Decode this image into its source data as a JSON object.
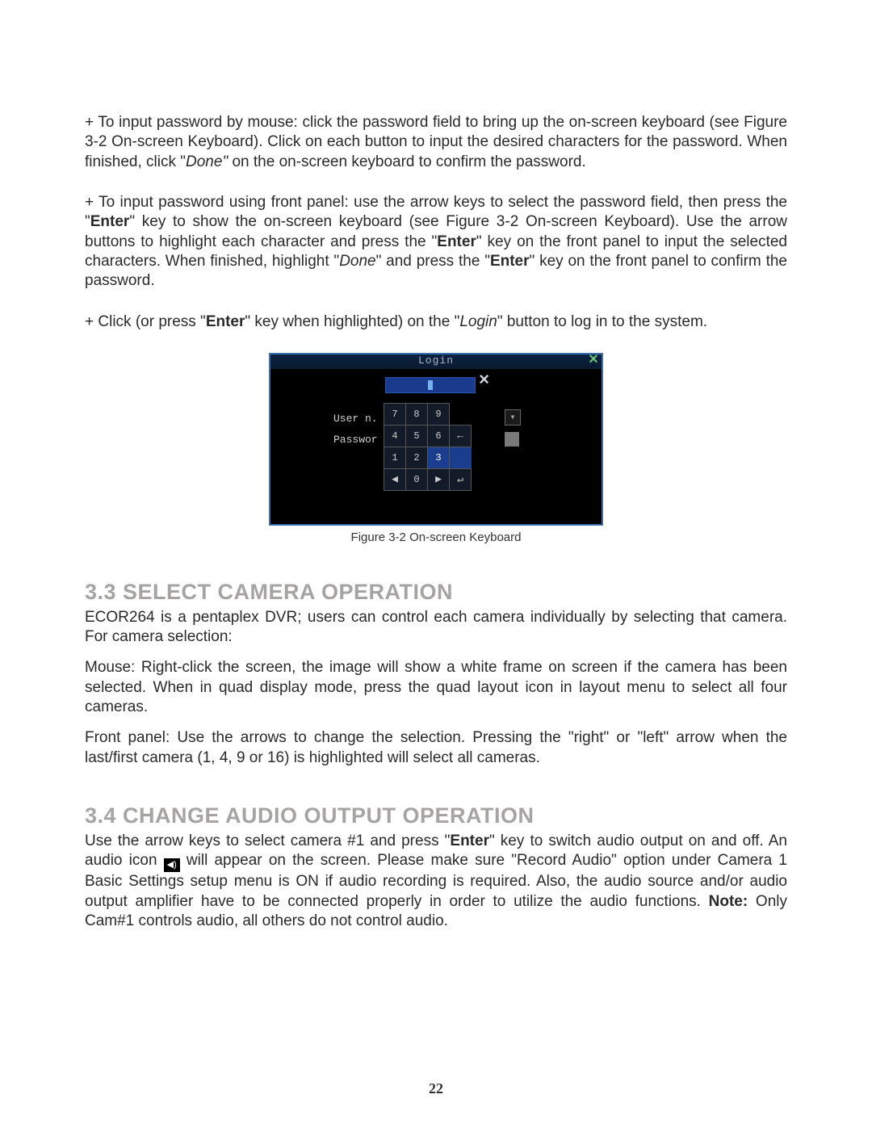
{
  "paragraphs": {
    "p1": {
      "pre": "+ To input password by mouse: click the password field to bring up the on-screen keyboard (see Figure 3-2 On-screen Keyboard). Click on each button to input the desired characters for the password. When finished, click \"",
      "done": "Done\"",
      "post": " on the on-screen keyboard to confirm the password."
    },
    "p2": {
      "s1": "+ To input password using front panel: use the arrow keys to select the password field, then press the \"",
      "enter1": "Enter",
      "s2": "\" key to show the on-screen keyboard (see Figure 3-2 On-screen Keyboard). Use the arrow buttons to highlight each character and press the \"",
      "enter2": "Enter",
      "s3": "\" key on the front panel to input the selected characters. When finished, highlight \"",
      "done": "Done",
      "s4": "\" and press the \"",
      "enter3": "Enter",
      "s5": "\" key on the front panel to confirm the password."
    },
    "p3": {
      "s1": "+ Click (or press \"",
      "enter": "Enter",
      "s2": "\" key when highlighted) on the \"",
      "login": "Login",
      "s3": "\" button to log in to the system."
    },
    "body33a": "ECOR264 is a pentaplex DVR; users can control each camera individually by selecting that camera. For camera selection:",
    "body33b": "Mouse: Right-click the screen, the image will show a white frame on screen if the camera has been selected. When in quad display mode, press the quad layout icon in layout menu to select all four cameras.",
    "body33c": "Front panel: Use the arrows to change the selection. Pressing the \"right\" or \"left\" arrow when the last/first camera (1, 4, 9 or 16) is highlighted will select all cameras.",
    "p34": {
      "s1": "Use the arrow keys to select camera #1 and press \"",
      "enter": "Enter",
      "s2": "\" key to switch audio output on and off. An audio icon ",
      "s3": " will appear on the screen. Please make sure \"Record Audio\" option under Camera 1 Basic Settings setup menu is ON if audio recording is required. Also, the audio source and/or audio output amplifier have to be connected properly in order to utilize the audio functions. ",
      "note": "Note:",
      "s4": " Only Cam#1 controls audio, all others do not control audio."
    }
  },
  "headings": {
    "h33": "3.3  SELECT CAMERA OPERATION",
    "h34": "3.4  CHANGE AUDIO OUTPUT OPERATION"
  },
  "figure": {
    "title": "Login",
    "close": "×",
    "labels": {
      "user": "User n.",
      "password": "Passwor"
    },
    "keypad": {
      "r0": [
        "7",
        "8",
        "9",
        ""
      ],
      "r1": [
        "4",
        "5",
        "6",
        "←"
      ],
      "r2": [
        "1",
        "2",
        "3",
        ""
      ],
      "r3": [
        "◀",
        "0",
        "▶",
        "↵"
      ]
    },
    "dropdown_icon": "▾",
    "caption": "Figure 3-2 On-screen Keyboard"
  },
  "pagenum": "22",
  "audio_icon_glyph": "◀)"
}
